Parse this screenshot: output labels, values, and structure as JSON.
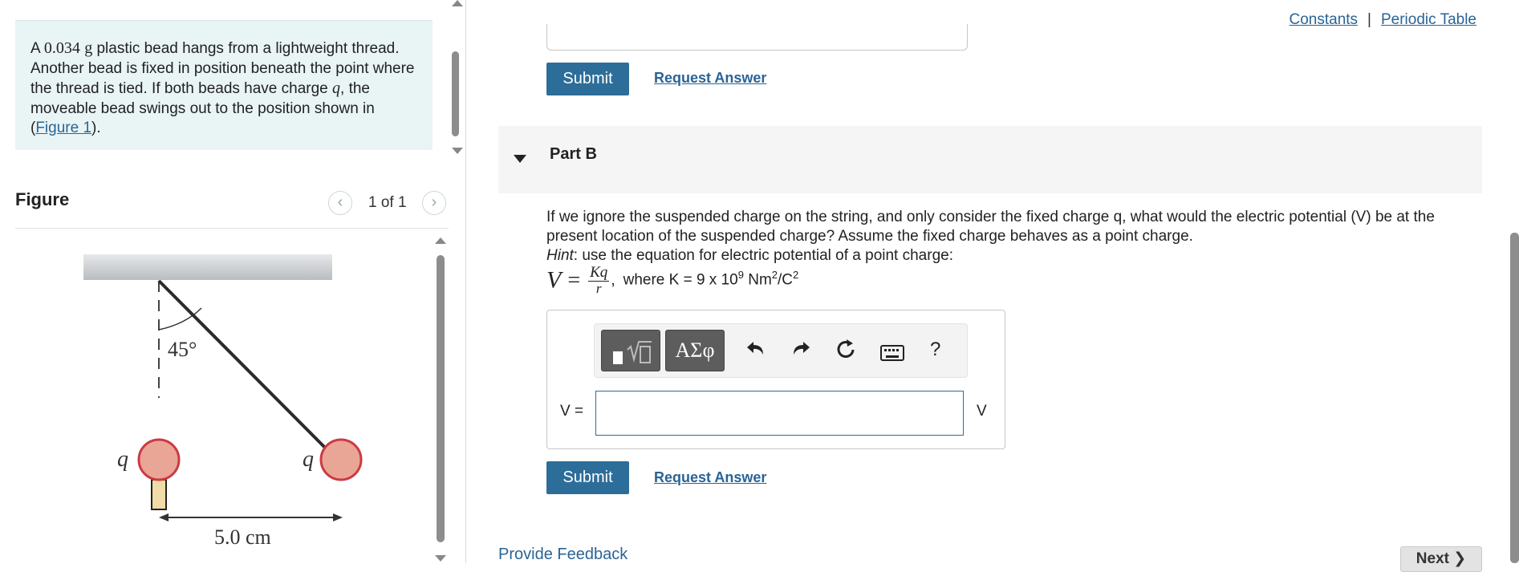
{
  "problem": {
    "text_1": "A ",
    "mass_value": "0.034",
    "mass_unit": "g",
    "text_2": " plastic bead hangs from a lightweight thread. Another bead is fixed in position beneath the point where the thread is tied. If both beads have charge ",
    "charge_symbol": "q",
    "text_3": ", the moveable bead swings out to the position shown in (",
    "figure_link": "Figure 1",
    "text_4": ")."
  },
  "figure": {
    "title": "Figure",
    "pager": "1 of 1",
    "prev_glyph": "‹",
    "next_glyph": "›",
    "angle_label": "45°",
    "left_charge": "q",
    "right_charge": "q",
    "distance_label": "5.0 cm"
  },
  "header_links": {
    "constants": "Constants",
    "separator": "|",
    "periodic_table": "Periodic Table"
  },
  "part_a": {
    "submit": "Submit",
    "request_answer": "Request Answer"
  },
  "part_b": {
    "title": "Part B",
    "question": "If we ignore the suspended charge on the string, and only consider the fixed charge q, what would the electric potential (V) be at the present location of the suspended charge? Assume the fixed charge behaves as a point charge.",
    "hint_label": "Hint",
    "hint_text": ": use the equation for electric potential of a point charge:",
    "formula_lhs": "V",
    "formula_eq": "=",
    "formula_num": "Kq",
    "formula_den": "r",
    "formula_comma": ",",
    "where_text": "where K = 9 x 10",
    "where_exp": "9",
    "where_units": " Nm",
    "where_units_exp": "2",
    "where_units_2": "/C",
    "where_units_exp2": "2",
    "toolbar_greek": "ΑΣφ",
    "toolbar_help": "?",
    "answer_label": "V =",
    "answer_value": "",
    "answer_unit": "V",
    "submit": "Submit",
    "request_answer": "Request Answer"
  },
  "footer": {
    "feedback": "Provide Feedback",
    "next": "Next ❯"
  }
}
